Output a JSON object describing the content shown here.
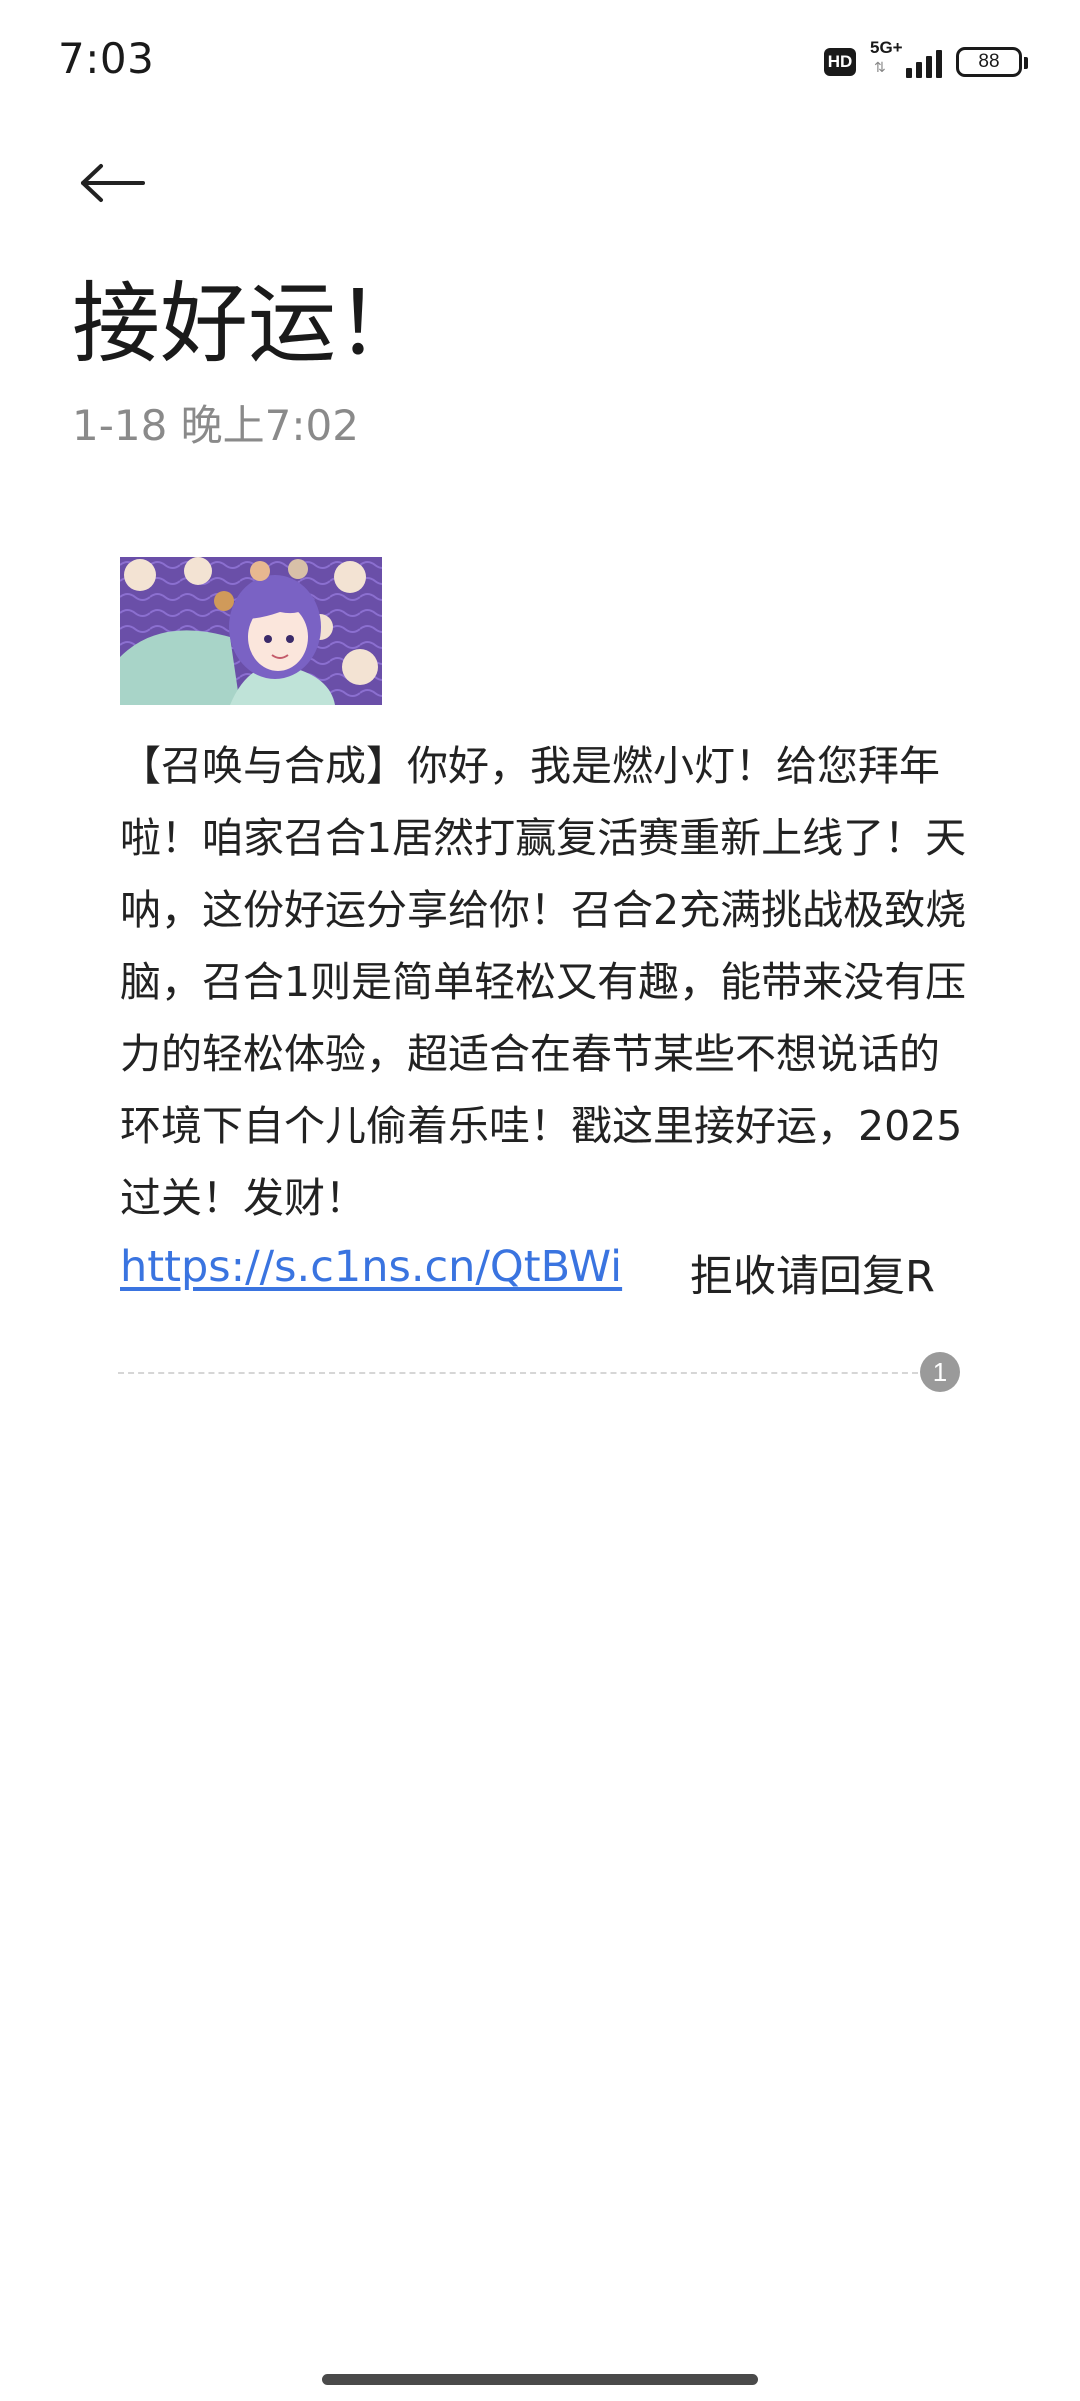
{
  "status_bar": {
    "time": "7:03",
    "hd_label": "HD",
    "network_label": "5G+",
    "battery_level": "88"
  },
  "header": {
    "back_icon": "arrow-left-icon",
    "title": "接好运！",
    "timestamp": "1-18 晚上7:02"
  },
  "message": {
    "image_alt": "anime character banner",
    "body": "【召唤与合成】你好，我是燃小灯！给您拜年啦！咱家召合1居然打赢复活赛重新上线了！天呐，这份好运分享给你！召合2充满挑战极致烧脑，召合1则是简单轻松又有趣，能带来没有压力的轻松体验，超适合在春节某些不想说话的环境下自个儿偷着乐哇！戳这里接好运，2025过关！发财！",
    "link": "https://s.c1ns.cn/QtBWi",
    "unsubscribe": "拒收请回复R",
    "sim_number": "1"
  },
  "colors": {
    "link": "#3a74e0",
    "timestamp": "#8a8a8a",
    "image_bg": "#6a4fa8"
  }
}
